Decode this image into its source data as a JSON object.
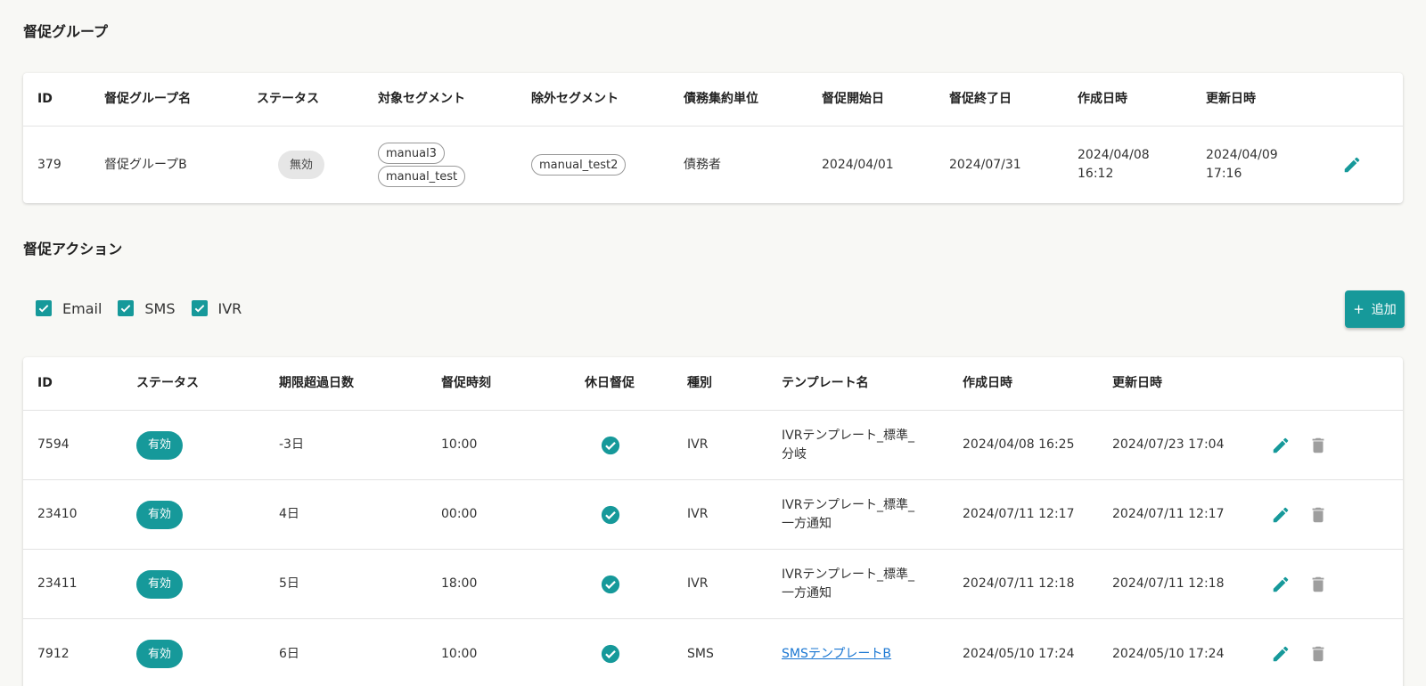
{
  "group_section": {
    "title": "督促グループ",
    "headers": [
      "ID",
      "督促グループ名",
      "ステータス",
      "対象セグメント",
      "除外セグメント",
      "債務集約単位",
      "督促開始日",
      "督促終了日",
      "作成日時",
      "更新日時"
    ],
    "rows": [
      {
        "id": "379",
        "name": "督促グループB",
        "status": "無効",
        "target_segments": [
          "manual3",
          "manual_test"
        ],
        "exclude_segments": [
          "manual_test2"
        ],
        "aggregation_unit": "債務者",
        "start_date": "2024/04/01",
        "end_date": "2024/07/31",
        "created_date": "2024/04/08",
        "created_time": "16:12",
        "updated_date": "2024/04/09",
        "updated_time": "17:16"
      }
    ]
  },
  "action_section": {
    "title": "督促アクション",
    "filters": [
      {
        "label": "Email",
        "checked": true
      },
      {
        "label": "SMS",
        "checked": true
      },
      {
        "label": "IVR",
        "checked": true
      }
    ],
    "add_button": {
      "icon": "plus-icon",
      "label": "追加"
    },
    "headers": [
      "ID",
      "ステータス",
      "期限超過日数",
      "督促時刻",
      "休日督促",
      "種別",
      "テンプレート名",
      "作成日時",
      "更新日時"
    ],
    "rows": [
      {
        "id": "7594",
        "status": "有効",
        "overdue_days": "-3日",
        "time": "10:00",
        "holiday": true,
        "type": "IVR",
        "template_line1": "IVRテンプレート_標準_",
        "template_line2": "分岐",
        "template_link": false,
        "created": "2024/04/08 16:25",
        "updated": "2024/07/23 17:04"
      },
      {
        "id": "23410",
        "status": "有効",
        "overdue_days": "4日",
        "time": "00:00",
        "holiday": true,
        "type": "IVR",
        "template_line1": "IVRテンプレート_標準_",
        "template_line2": "一方通知",
        "template_link": false,
        "created": "2024/07/11 12:17",
        "updated": "2024/07/11 12:17"
      },
      {
        "id": "23411",
        "status": "有効",
        "overdue_days": "5日",
        "time": "18:00",
        "holiday": true,
        "type": "IVR",
        "template_line1": "IVRテンプレート_標準_",
        "template_line2": "一方通知",
        "template_link": false,
        "created": "2024/07/11 12:18",
        "updated": "2024/07/11 12:18"
      },
      {
        "id": "7912",
        "status": "有効",
        "overdue_days": "6日",
        "time": "10:00",
        "holiday": true,
        "type": "SMS",
        "template_line1": "SMSテンプレートB",
        "template_line2": "",
        "template_link": true,
        "created": "2024/05/10 17:24",
        "updated": "2024/05/10 17:24"
      }
    ]
  },
  "colors": {
    "accent": "#16999a",
    "link": "#1976d2",
    "delete_icon": "#9e9e9e",
    "disabled_chip": "#e6e6e6"
  }
}
